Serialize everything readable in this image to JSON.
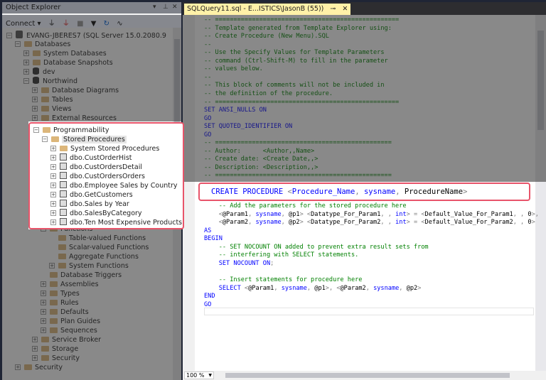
{
  "object_explorer": {
    "title": "Object Explorer",
    "window_controls": [
      "▾",
      "⊥",
      "✕"
    ],
    "toolbar": {
      "connect": "Connect ▾",
      "icons": [
        "connect-icon",
        "disconnect-icon",
        "stop-icon",
        "filter-icon",
        "refresh-icon",
        "activity-icon"
      ]
    },
    "tree": [
      {
        "label": "EVANG-JBERES7 (SQL Server 15.0.2080.9",
        "level": 0,
        "exp": "-",
        "icon": "server"
      },
      {
        "label": "Databases",
        "level": 1,
        "exp": "-",
        "icon": "folder"
      },
      {
        "label": "System Databases",
        "level": 2,
        "exp": "+",
        "icon": "folder"
      },
      {
        "label": "Database Snapshots",
        "level": 2,
        "exp": "+",
        "icon": "folder"
      },
      {
        "label": "dev",
        "level": 2,
        "exp": "+",
        "icon": "db"
      },
      {
        "label": "Northwind",
        "level": 2,
        "exp": "-",
        "icon": "db"
      },
      {
        "label": "Database Diagrams",
        "level": 3,
        "exp": "+",
        "icon": "folder"
      },
      {
        "label": "Tables",
        "level": 3,
        "exp": "+",
        "icon": "folder"
      },
      {
        "label": "Views",
        "level": 3,
        "exp": "+",
        "icon": "folder"
      },
      {
        "label": "External Resources",
        "level": 3,
        "exp": "+",
        "icon": "folder"
      },
      {
        "label": "Programmability",
        "level": 3,
        "exp": "-",
        "icon": "folder"
      },
      {
        "label": "Stored Procedures",
        "level": 4,
        "exp": "-",
        "icon": "folder",
        "selected": true
      },
      {
        "label": "System Stored Procedures",
        "level": 5,
        "exp": "+",
        "icon": "folder"
      },
      {
        "label": "dbo.CustOrderHist",
        "level": 5,
        "exp": "+",
        "icon": "sp"
      },
      {
        "label": "dbo.CustOrdersDetail",
        "level": 5,
        "exp": "+",
        "icon": "sp"
      },
      {
        "label": "dbo.CustOrdersOrders",
        "level": 5,
        "exp": "+",
        "icon": "sp"
      },
      {
        "label": "dbo.Employee Sales by Country",
        "level": 5,
        "exp": "+",
        "icon": "sp"
      },
      {
        "label": "dbo.GetCustomers",
        "level": 5,
        "exp": "+",
        "icon": "sp"
      },
      {
        "label": "dbo.Sales by Year",
        "level": 5,
        "exp": "+",
        "icon": "sp"
      },
      {
        "label": "dbo.SalesByCategory",
        "level": 5,
        "exp": "+",
        "icon": "sp"
      },
      {
        "label": "dbo.Ten Most Expensive Products",
        "level": 5,
        "exp": "+",
        "icon": "sp"
      },
      {
        "label": "Functions",
        "level": 4,
        "exp": "-",
        "icon": "folder"
      },
      {
        "label": "Table-valued Functions",
        "level": 5,
        "exp": "",
        "icon": "folder"
      },
      {
        "label": "Scalar-valued Functions",
        "level": 5,
        "exp": "",
        "icon": "folder"
      },
      {
        "label": "Aggregate Functions",
        "level": 5,
        "exp": "",
        "icon": "folder"
      },
      {
        "label": "System Functions",
        "level": 5,
        "exp": "+",
        "icon": "folder"
      },
      {
        "label": "Database Triggers",
        "level": 4,
        "exp": "",
        "icon": "folder"
      },
      {
        "label": "Assemblies",
        "level": 4,
        "exp": "+",
        "icon": "folder"
      },
      {
        "label": "Types",
        "level": 4,
        "exp": "+",
        "icon": "folder"
      },
      {
        "label": "Rules",
        "level": 4,
        "exp": "+",
        "icon": "folder"
      },
      {
        "label": "Defaults",
        "level": 4,
        "exp": "+",
        "icon": "folder"
      },
      {
        "label": "Plan Guides",
        "level": 4,
        "exp": "+",
        "icon": "folder"
      },
      {
        "label": "Sequences",
        "level": 4,
        "exp": "+",
        "icon": "folder"
      },
      {
        "label": "Service Broker",
        "level": 3,
        "exp": "+",
        "icon": "folder"
      },
      {
        "label": "Storage",
        "level": 3,
        "exp": "+",
        "icon": "folder"
      },
      {
        "label": "Security",
        "level": 3,
        "exp": "+",
        "icon": "folder"
      },
      {
        "label": "Security",
        "level": 1,
        "exp": "+",
        "icon": "folder"
      }
    ]
  },
  "editor": {
    "tab_title": "SQLQuery11.sql - E...ISTICS\\JasonB (55))",
    "tab_pin": "⊸",
    "tab_close": "✕",
    "zoom": "100 %",
    "lines": [
      [
        [
          "-- ==================================================",
          "c"
        ]
      ],
      [
        [
          "-- Template generated from Template Explorer using:",
          "c"
        ]
      ],
      [
        [
          "-- Create Procedure (New Menu).SQL",
          "c"
        ]
      ],
      [
        [
          "--",
          "c"
        ]
      ],
      [
        [
          "-- Use the Specify Values for Template Parameters",
          "c"
        ]
      ],
      [
        [
          "-- command (Ctrl-Shift-M) to fill in the parameter",
          "c"
        ]
      ],
      [
        [
          "-- values below.",
          "c"
        ]
      ],
      [
        [
          "--",
          "c"
        ]
      ],
      [
        [
          "-- This block of comments will not be included in",
          "c"
        ]
      ],
      [
        [
          "-- the definition of the procedure.",
          "c"
        ]
      ],
      [
        [
          "-- ==================================================",
          "c"
        ]
      ],
      [
        [
          "SET ANSI_NULLS ON",
          "k"
        ]
      ],
      [
        [
          "GO",
          "k"
        ]
      ],
      [
        [
          "SET QUOTED_IDENTIFIER ON",
          "k"
        ]
      ],
      [
        [
          "GO",
          "k"
        ]
      ],
      [
        [
          "-- ================================================",
          "c"
        ]
      ],
      [
        [
          "-- Author:      <Author,,Name>",
          "c"
        ]
      ],
      [
        [
          "-- Create date: <Create Date,,>",
          "c"
        ]
      ],
      [
        [
          "-- Description: <Description,,>",
          "c"
        ]
      ],
      [
        [
          "-- ================================================",
          "c"
        ]
      ],
      [],
      [
        [
          "    -- Add the parameters for the stored procedure here",
          "c"
        ]
      ],
      [
        [
          "    <",
          "g"
        ],
        [
          "@Param1",
          "t"
        ],
        [
          ", ",
          "g"
        ],
        [
          "sysname",
          "k"
        ],
        [
          ", ",
          "g"
        ],
        [
          "@p1",
          "t"
        ],
        [
          "> <",
          "g"
        ],
        [
          "Datatype_For_Param1",
          "t"
        ],
        [
          ", , ",
          "g"
        ],
        [
          "int",
          "k"
        ],
        [
          "> = <",
          "g"
        ],
        [
          "Default_Value_For_Param1",
          "t"
        ],
        [
          ", , ",
          "g"
        ],
        [
          "0",
          "t"
        ],
        [
          ">,",
          "g"
        ]
      ],
      [
        [
          "    <",
          "g"
        ],
        [
          "@Param2",
          "t"
        ],
        [
          ", ",
          "g"
        ],
        [
          "sysname",
          "k"
        ],
        [
          ", ",
          "g"
        ],
        [
          "@p2",
          "t"
        ],
        [
          "> <",
          "g"
        ],
        [
          "Datatype_For_Param2",
          "t"
        ],
        [
          ", , ",
          "g"
        ],
        [
          "int",
          "k"
        ],
        [
          "> = <",
          "g"
        ],
        [
          "Default_Value_For_Param2",
          "t"
        ],
        [
          ", , ",
          "g"
        ],
        [
          "0",
          "t"
        ],
        [
          ">",
          "g"
        ]
      ],
      [
        [
          "AS",
          "k"
        ]
      ],
      [
        [
          "BEGIN",
          "k"
        ]
      ],
      [
        [
          "    -- SET NOCOUNT ON added to prevent extra result sets from",
          "c"
        ]
      ],
      [
        [
          "    -- interfering with SELECT statements.",
          "c"
        ]
      ],
      [
        [
          "    SET NOCOUNT ON",
          "k"
        ],
        [
          ";",
          "g"
        ]
      ],
      [],
      [
        [
          "    -- Insert statements for procedure here",
          "c"
        ]
      ],
      [
        [
          "    SELECT ",
          "k"
        ],
        [
          "<",
          "g"
        ],
        [
          "@Param1",
          "t"
        ],
        [
          ", ",
          "g"
        ],
        [
          "sysname",
          "k"
        ],
        [
          ", ",
          "g"
        ],
        [
          "@p1",
          "t"
        ],
        [
          ">, <",
          "g"
        ],
        [
          "@Param2",
          "t"
        ],
        [
          ", ",
          "g"
        ],
        [
          "sysname",
          "k"
        ],
        [
          ", ",
          "g"
        ],
        [
          "@p2",
          "t"
        ],
        [
          ">",
          "g"
        ]
      ],
      [
        [
          "END",
          "k"
        ]
      ],
      [
        [
          "GO",
          "k"
        ]
      ]
    ],
    "highlight_line": [
      [
        "CREATE PROCEDURE ",
        "k"
      ],
      [
        "<",
        "g"
      ],
      [
        "Procedure_Name",
        "k"
      ],
      [
        ", ",
        "g"
      ],
      [
        "sysname",
        "k"
      ],
      [
        ", ",
        "g"
      ],
      [
        "ProcedureName",
        "t"
      ],
      [
        ">",
        "g"
      ]
    ]
  },
  "colors": {
    "highlight_border": "#e8546a",
    "comment": "#008000",
    "keyword": "#0000ff"
  }
}
